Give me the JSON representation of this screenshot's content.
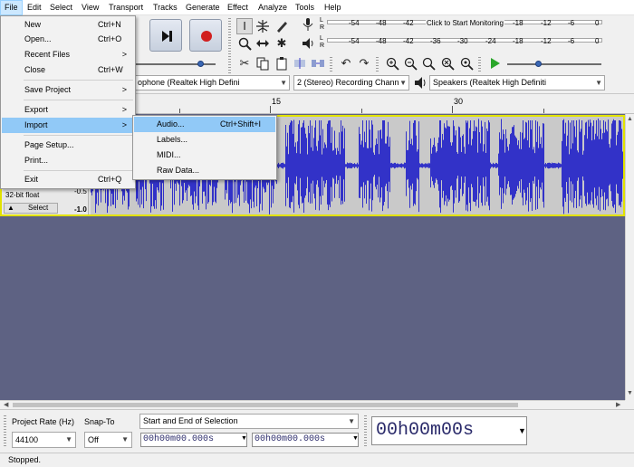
{
  "menubar": {
    "items": [
      "File",
      "Edit",
      "Select",
      "View",
      "Transport",
      "Tracks",
      "Generate",
      "Effect",
      "Analyze",
      "Tools",
      "Help"
    ]
  },
  "meters": {
    "record_scale": [
      "-54",
      "-48",
      "-42"
    ],
    "monitor_label": "Click to Start Monitoring",
    "record_scale_right": [
      "-18",
      "-12",
      "-6",
      "0"
    ],
    "playback_scale": [
      "-54",
      "-48",
      "-42",
      "-36",
      "-30",
      "-24",
      "-18",
      "-12",
      "-6",
      "0"
    ],
    "channel_l": "L",
    "channel_r": "R"
  },
  "devices": {
    "input_device": "ophone (Realtek High Defini",
    "channels": "2 (Stereo) Recording Chann",
    "output_device": "Speakers (Realtek High Definiti"
  },
  "timeline": {
    "labels": [
      "15",
      "30"
    ]
  },
  "track": {
    "format": "32-bit float",
    "format_partial": "",
    "select_label": "Select",
    "scale_top": "-0.5",
    "scale_bottom": "-1.0"
  },
  "file_menu": {
    "items": [
      {
        "label": "New",
        "shortcut": "Ctrl+N"
      },
      {
        "label": "Open...",
        "shortcut": "Ctrl+O"
      },
      {
        "label": "Recent Files",
        "submenu": ">"
      },
      {
        "label": "Close",
        "shortcut": "Ctrl+W"
      },
      {
        "label": "Save Project",
        "submenu": ">"
      },
      {
        "label": "Export",
        "submenu": ">"
      },
      {
        "label": "Import",
        "submenu": ">"
      },
      {
        "label": "Page Setup..."
      },
      {
        "label": "Print..."
      },
      {
        "label": "Exit",
        "shortcut": "Ctrl+Q"
      }
    ]
  },
  "import_submenu": {
    "items": [
      {
        "label": "Audio...",
        "shortcut": "Ctrl+Shift+I"
      },
      {
        "label": "Labels..."
      },
      {
        "label": "MIDI..."
      },
      {
        "label": "Raw Data..."
      }
    ]
  },
  "selection_toolbar": {
    "project_rate_label": "Project Rate (Hz)",
    "project_rate_value": "44100",
    "snap_to_label": "Snap-To",
    "snap_to_value": "Off",
    "selection_mode": "Start and End of Selection",
    "start_time": "00h00m00.000s",
    "end_time": "00h00m00.000s",
    "position_time": "00h00m00s"
  },
  "status": {
    "text": "Stopped."
  },
  "colors": {
    "waveform": "#3232c8",
    "workspace": "#5e6283",
    "track_border": "#e2e200",
    "menu_highlight": "#91c9f7"
  }
}
